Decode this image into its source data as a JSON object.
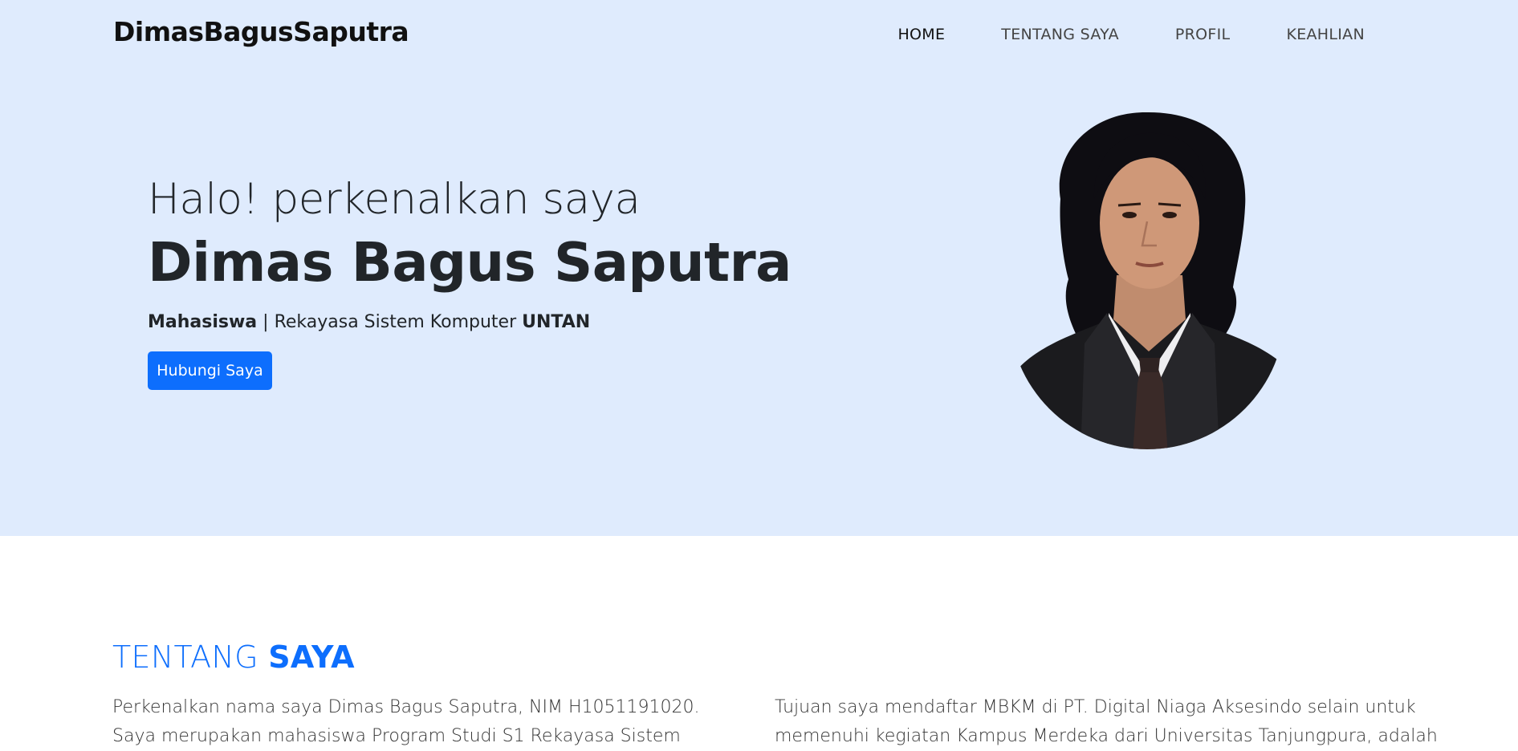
{
  "brand": "DimasBagusSaputra",
  "nav": {
    "home": "HOME",
    "about": "TENTANG SAYA",
    "profile": "PROFIL",
    "skills": "KEAHLIAN"
  },
  "hero": {
    "greeting": "Halo! perkenalkan saya",
    "name": "Dimas Bagus Saputra",
    "role_bold": "Mahasiswa",
    "separator": " | ",
    "program": "Rekayasa Sistem Komputer ",
    "university": "UNTAN",
    "button": "Hubungi Saya"
  },
  "about": {
    "title_light": "TENTANG ",
    "title_bold": "SAYA",
    "left_line1": "Perkenalkan nama saya Dimas Bagus Saputra, NIM H1051191020.",
    "left_line2": "Saya merupakan mahasiswa Program Studi S1 Rekayasa Sistem",
    "right_line1": "Tujuan saya mendaftar MBKM di PT. Digital Niaga Aksesindo selain untuk",
    "right_line2": "memenuhi kegiatan Kampus Merdeka dari Universitas Tanjungpura, adalah"
  },
  "colors": {
    "hero_bg": "#dfebfd",
    "accent": "#0d6efd",
    "text": "#212529"
  }
}
